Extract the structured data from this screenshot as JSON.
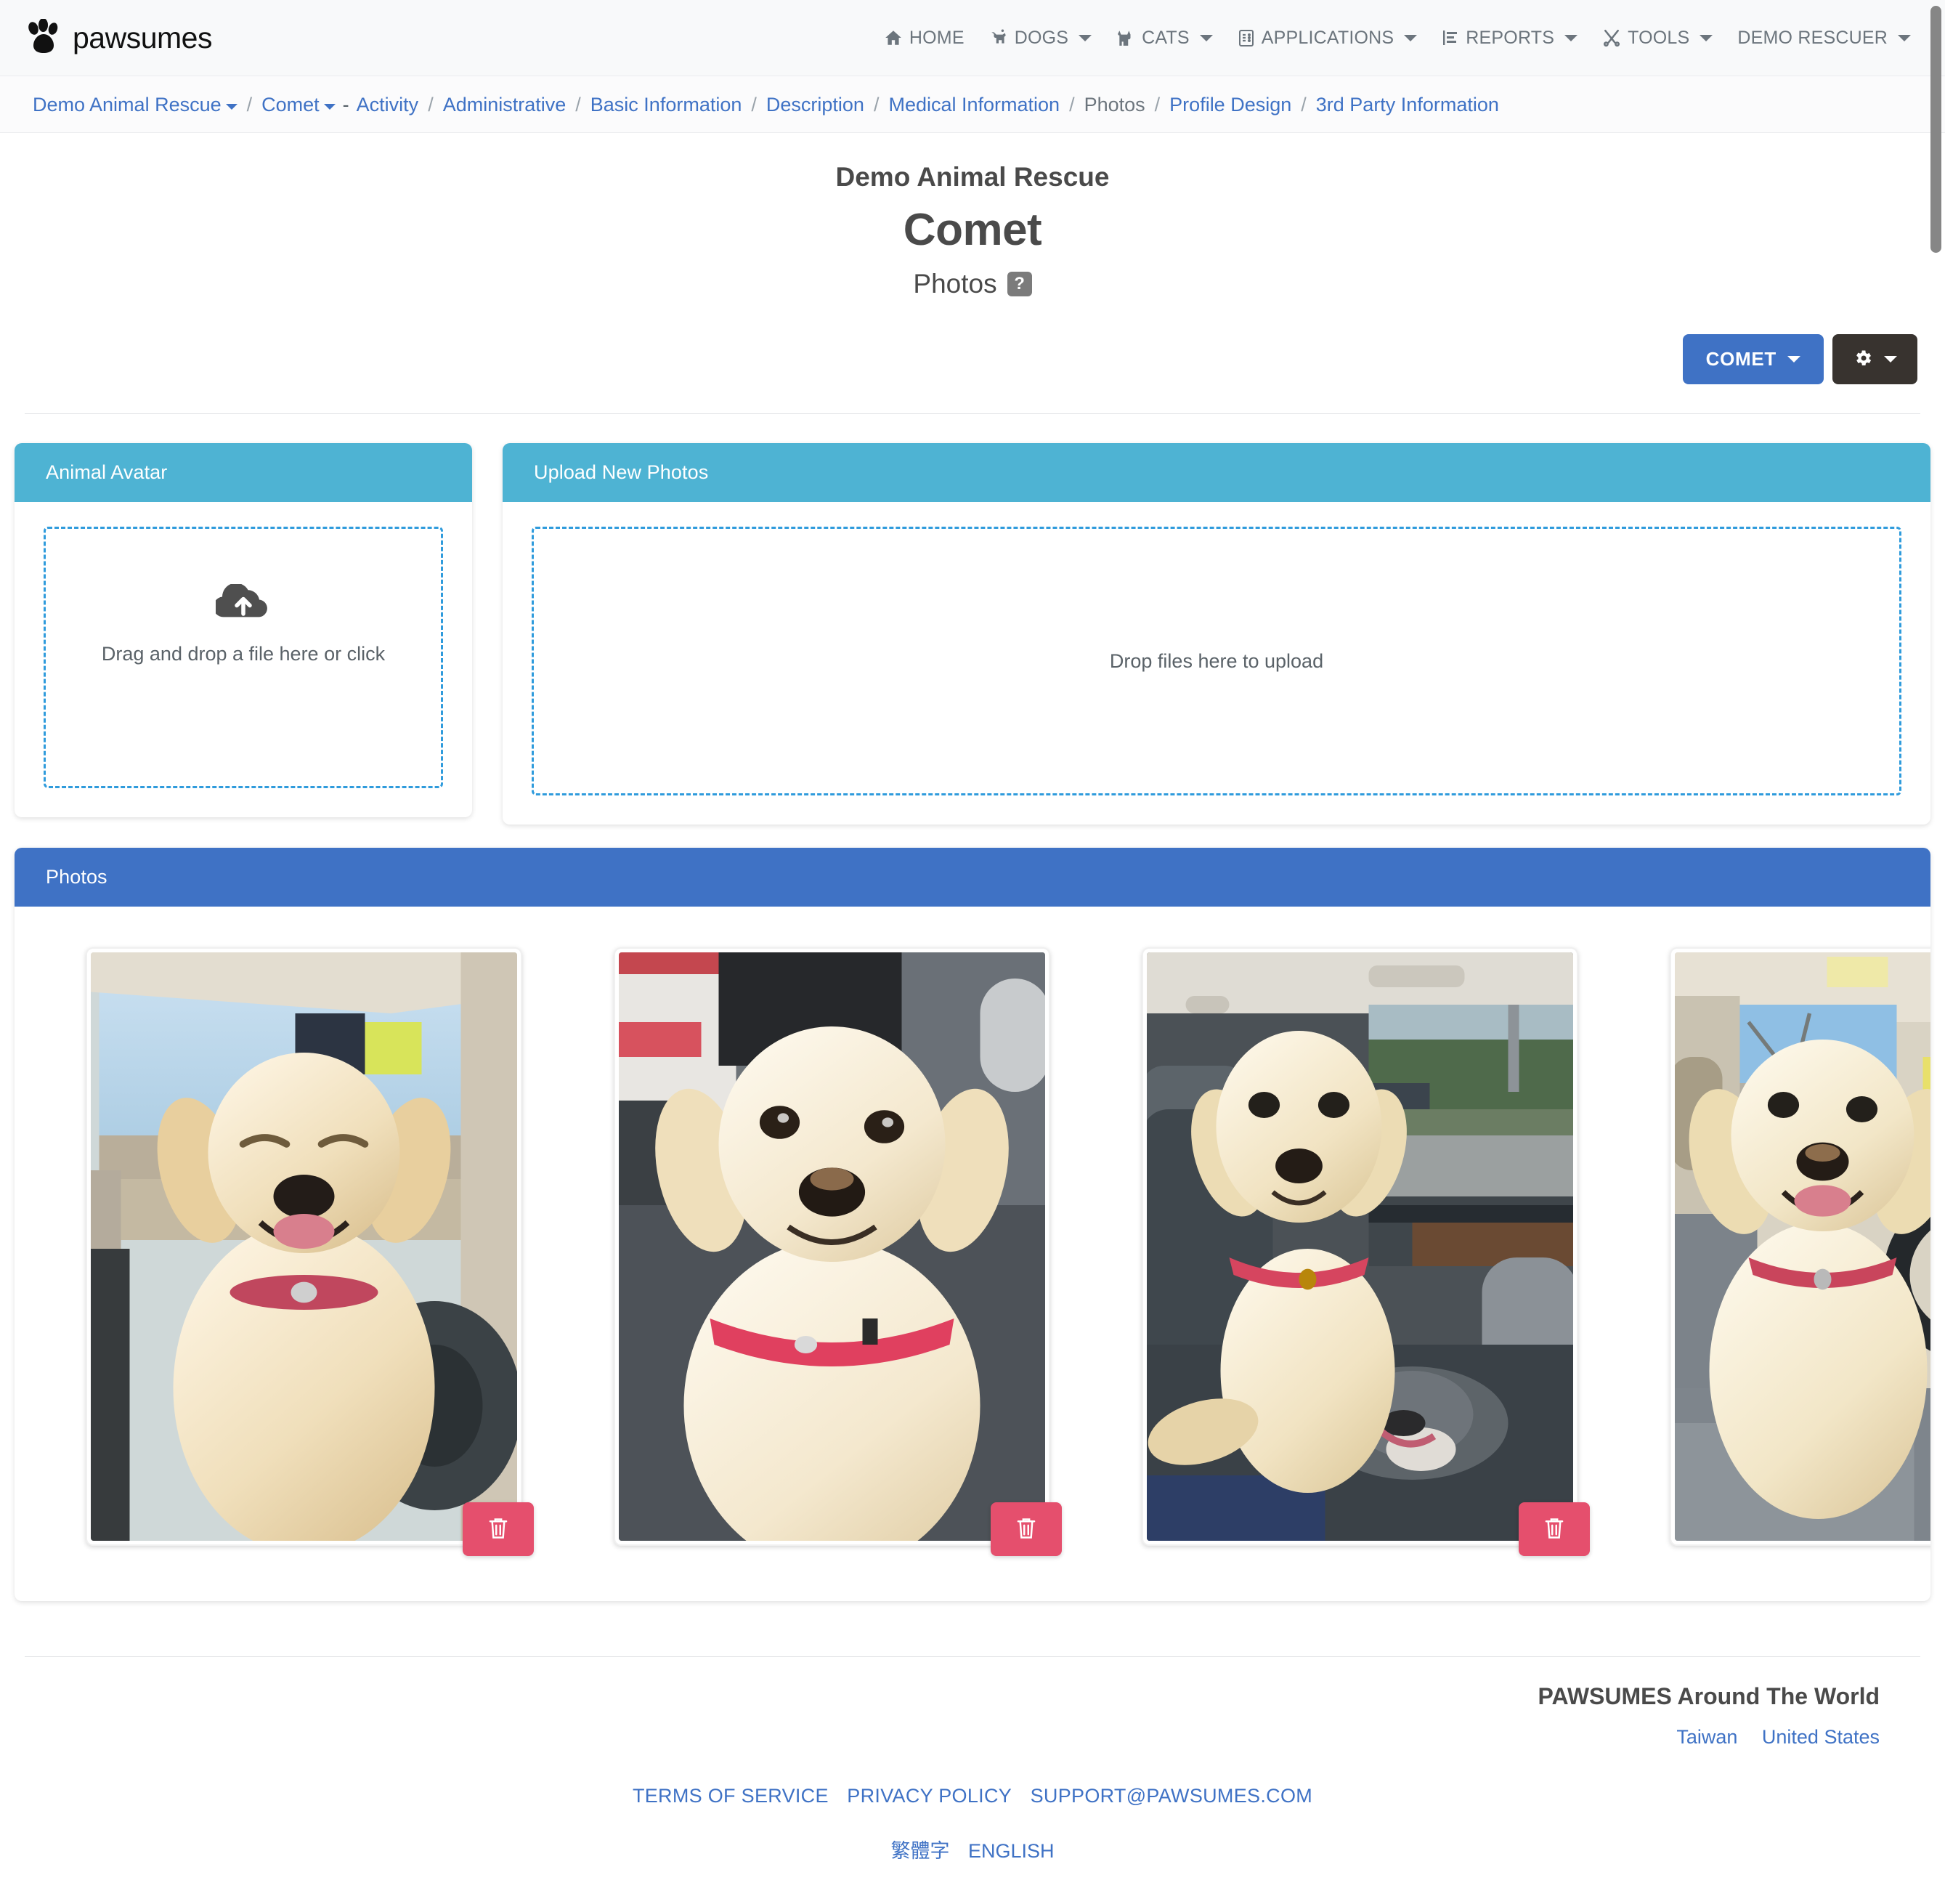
{
  "navbar": {
    "brand": "pawsumes",
    "brand_icon": "paw-print-icon",
    "items": [
      {
        "label": "HOME",
        "icon": "home-icon",
        "caret": false
      },
      {
        "label": "DOGS",
        "icon": "dog-icon",
        "caret": true
      },
      {
        "label": "CATS",
        "icon": "cat-icon",
        "caret": true
      },
      {
        "label": "APPLICATIONS",
        "icon": "clipboard-icon",
        "caret": true
      },
      {
        "label": "REPORTS",
        "icon": "chart-bar-icon",
        "caret": true
      },
      {
        "label": "TOOLS",
        "icon": "tools-icon",
        "caret": true
      },
      {
        "label": "DEMO RESCUER",
        "icon": "",
        "caret": true
      }
    ]
  },
  "breadcrumb": {
    "org": "Demo Animal Rescue",
    "animal": "Comet",
    "dash": "-",
    "items": [
      {
        "label": "Activity",
        "current": false
      },
      {
        "label": "Administrative",
        "current": false
      },
      {
        "label": "Basic Information",
        "current": false
      },
      {
        "label": "Description",
        "current": false
      },
      {
        "label": "Medical Information",
        "current": false
      },
      {
        "label": "Photos",
        "current": true
      },
      {
        "label": "Profile Design",
        "current": false
      },
      {
        "label": "3rd Party Information",
        "current": false
      }
    ],
    "separator": "/"
  },
  "header": {
    "org_name": "Demo Animal Rescue",
    "animal_name": "Comet",
    "section": "Photos",
    "help_badge": "?"
  },
  "actions": {
    "animal_button": "COMET",
    "settings_icon": "gear-icon"
  },
  "avatar_card": {
    "title": "Animal Avatar",
    "dropzone_text": "Drag and drop a file here or click",
    "dropzone_icon": "cloud-upload-icon"
  },
  "upload_card": {
    "title": "Upload New Photos",
    "dropzone_text": "Drop files here to upload"
  },
  "photos_card": {
    "title": "Photos",
    "delete_icon": "trash-icon",
    "items": [
      {
        "alt": "Golden retriever sitting in car front seat, eyes closed, smiling"
      },
      {
        "alt": "Cream golden retriever puppy with red collar in car"
      },
      {
        "alt": "Golden retriever sitting on gray pit bull in car back seat"
      },
      {
        "alt": "Golden retriever in driver seat next to steering wheel"
      }
    ]
  },
  "footer": {
    "world_title": "PAWSUMES Around The World",
    "world_links": [
      "Taiwan",
      "United States"
    ],
    "legal_links": [
      "TERMS OF SERVICE",
      "PRIVACY POLICY",
      "SUPPORT@PAWSUMES.COM"
    ],
    "lang_links": [
      "繁體字",
      "ENGLISH"
    ]
  },
  "colors": {
    "primary": "#3f72c5",
    "teal": "#4eb3d3",
    "danger": "#e54f6d",
    "dark": "#38332f",
    "dropzone_border": "#2f9bdc"
  }
}
